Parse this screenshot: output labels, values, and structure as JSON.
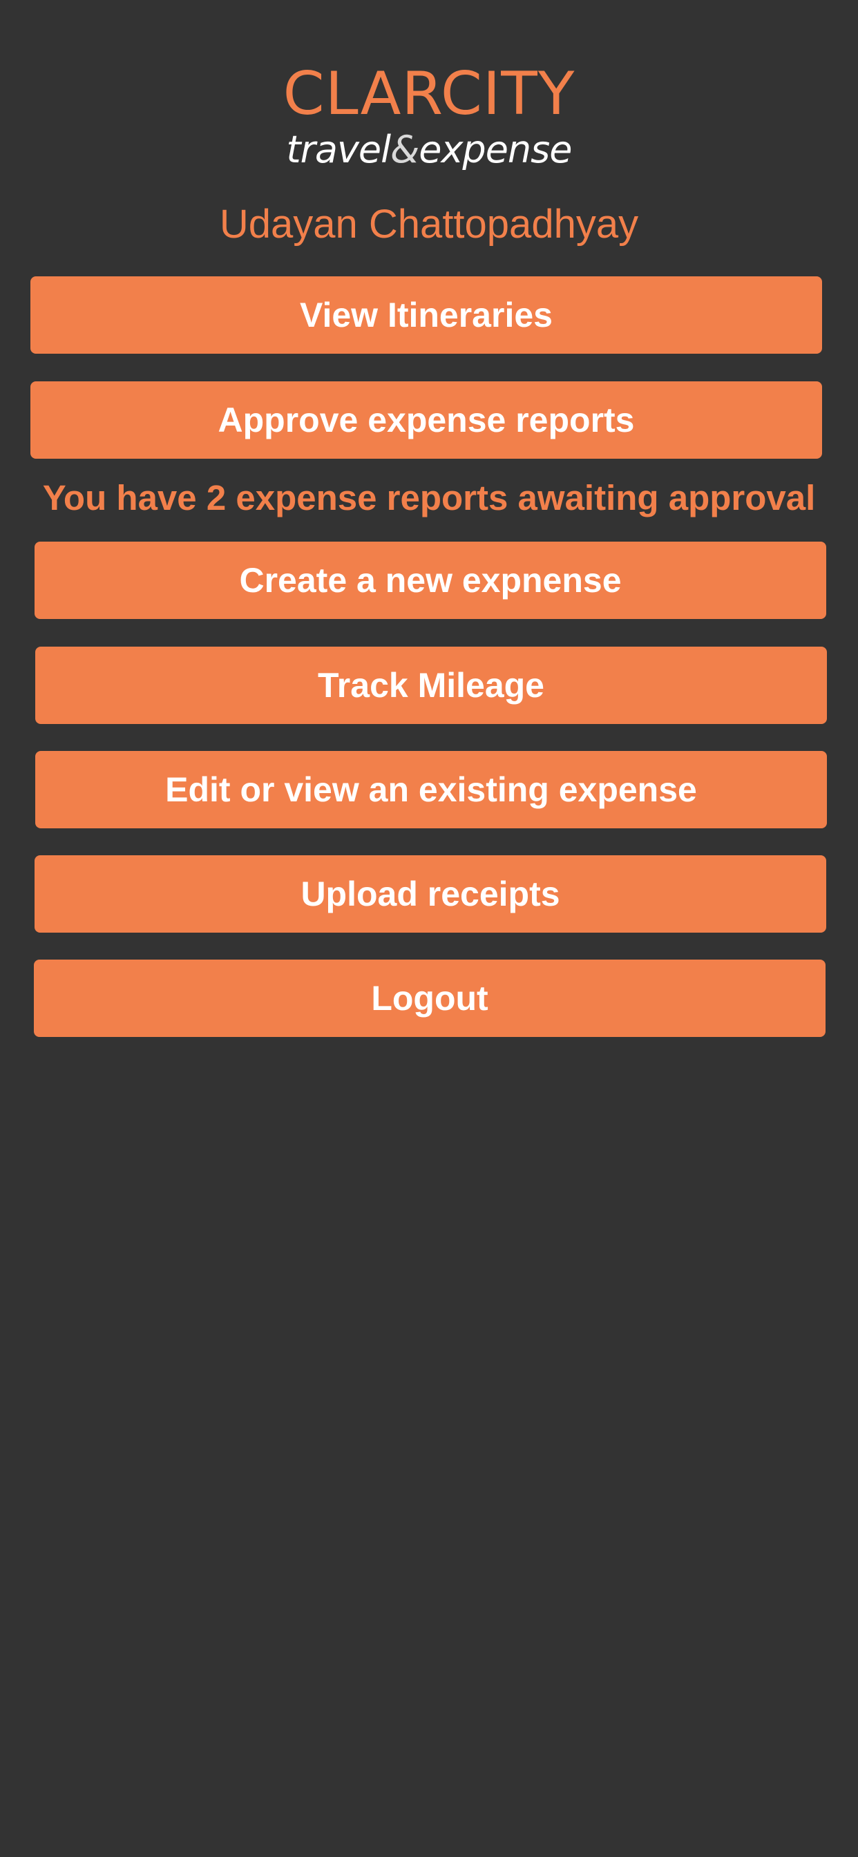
{
  "brand": {
    "name": "CLARCITY",
    "tagline_part1": "travel",
    "tagline_amp": "&",
    "tagline_part2": "expense",
    "accent_color": "#f2804b",
    "background_color": "#333333"
  },
  "user": {
    "name": "Udayan Chattopadhyay"
  },
  "menu": {
    "view_itineraries": "View Itineraries",
    "approve_reports": "Approve expense reports",
    "approval_notice": "You have 2 expense reports awaiting approval",
    "create_expense": "Create a new expnense",
    "track_mileage": "Track Mileage",
    "edit_expense": "Edit or view an existing expense",
    "upload_receipts": "Upload receipts",
    "logout": "Logout"
  }
}
